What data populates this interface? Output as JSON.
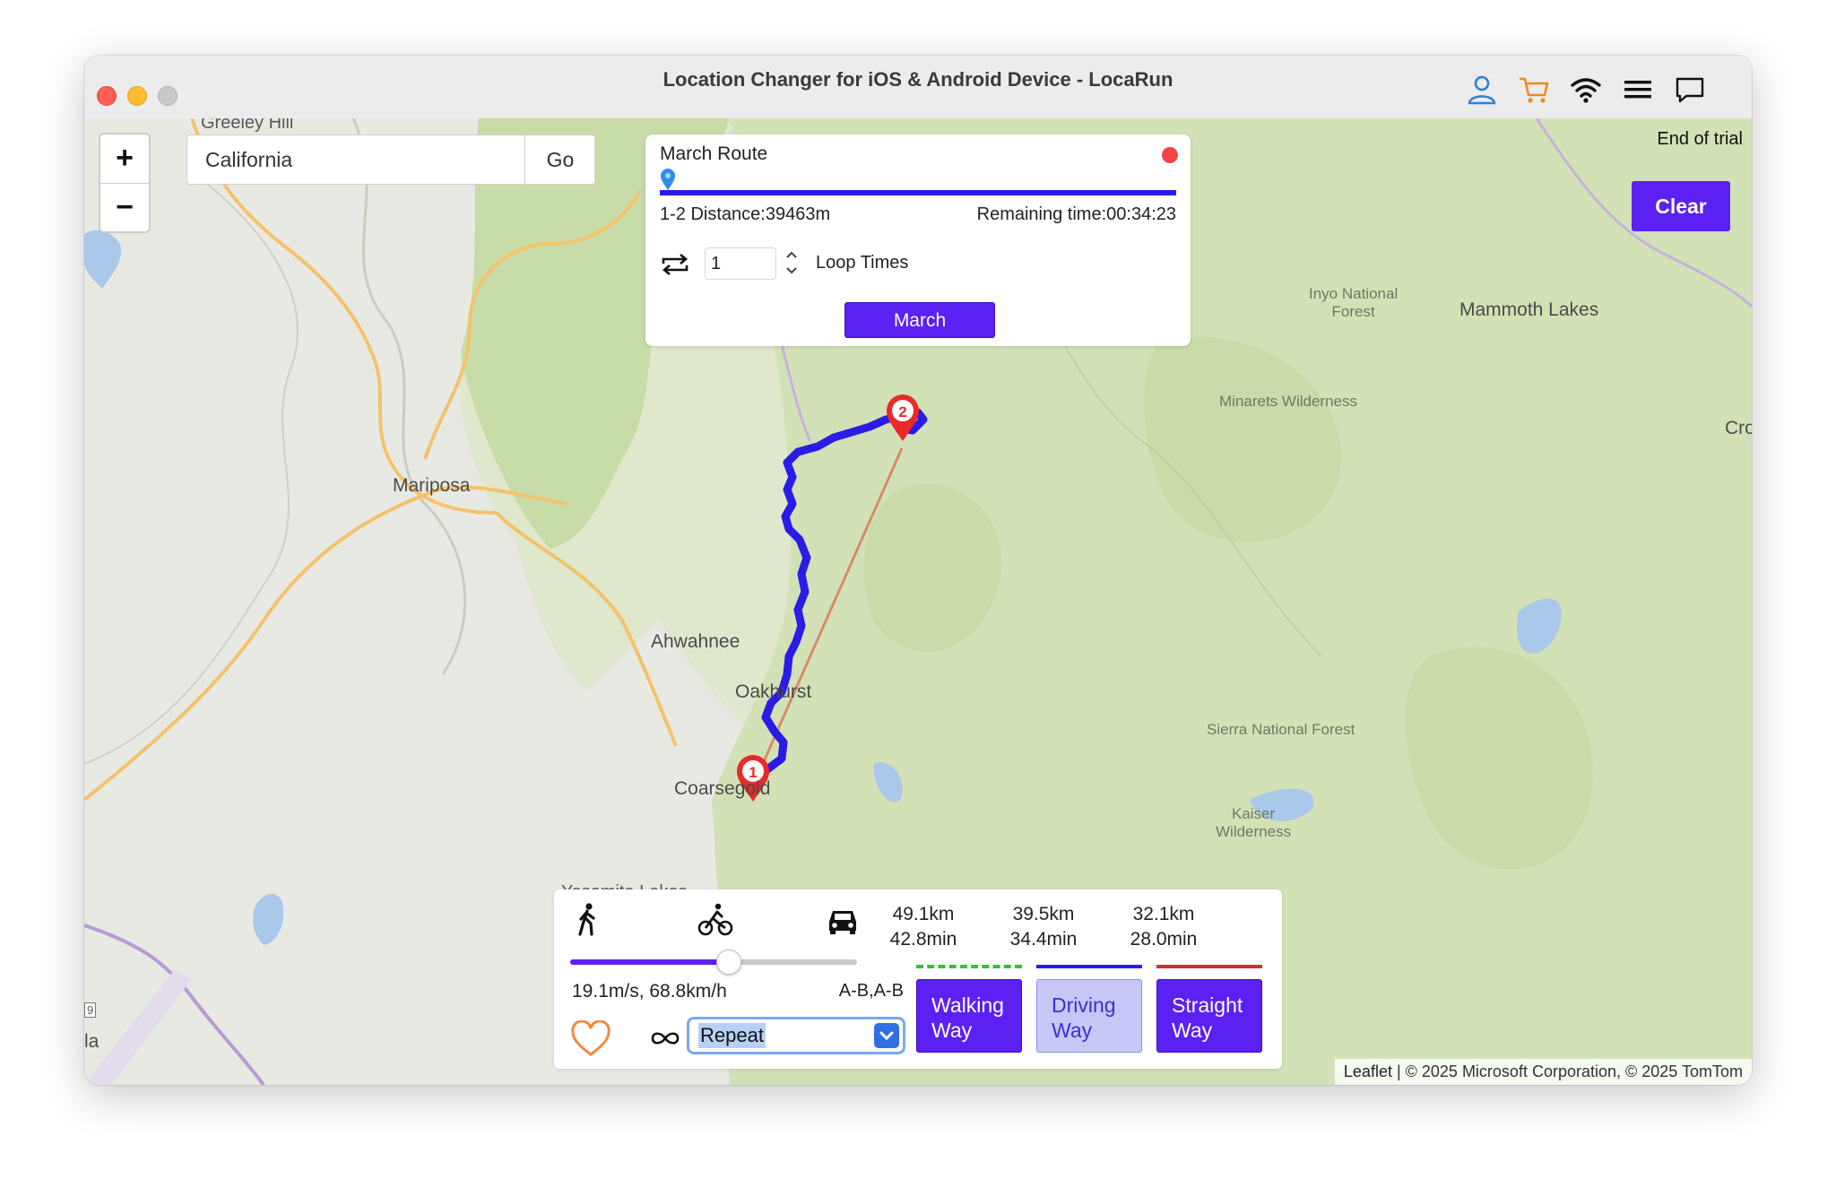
{
  "window": {
    "title": "Location Changer for iOS & Android Device - LocaRun",
    "toolbar_icons": [
      "user-icon",
      "cart-icon",
      "wifi-icon",
      "menu-icon",
      "chat-icon"
    ]
  },
  "map": {
    "zoom_in_label": "+",
    "zoom_out_label": "−",
    "search": {
      "value": "California",
      "placeholder": "",
      "go_label": "Go"
    },
    "trial_label": "End of trial",
    "clear_label": "Clear",
    "labels": {
      "greeley_hill": "Greeley Hill",
      "mariposa": "Mariposa",
      "ahwahnee": "Ahwahnee",
      "oakhurst": "Oakhurst",
      "coarsegold": "Coarsegold",
      "yosemite_lakes": "Yosemite Lakes",
      "mammoth_lakes": "Mammoth Lakes",
      "inyo_forest": "Inyo National\nForest",
      "minarets": "Minarets Wilderness",
      "sierra_forest": "Sierra National Forest",
      "kaiser": "Kaiser\nWilderness",
      "cro": "Cro",
      "la": "la",
      "route_shield": "9"
    },
    "markers": [
      {
        "label": "1"
      },
      {
        "label": "2"
      }
    ],
    "attribution": {
      "leaflet": "Leaflet",
      "text": " | © 2025 Microsoft Corporation, © 2025 TomTom"
    }
  },
  "route_panel": {
    "title": "March Route",
    "distance": "1-2 Distance:39463m",
    "remaining": "Remaining time:00:34:23",
    "loop_value": "1",
    "loop_label": "Loop Times",
    "march_label": "March",
    "progress": 0
  },
  "bottom_panel": {
    "speed_fraction": 0.55,
    "speed_text": "19.1m/s, 68.8km/h",
    "pattern": "A-B,A-B",
    "mode_select": "Repeat",
    "modes": [
      "walk-icon",
      "bike-icon",
      "car-icon"
    ],
    "routes": [
      {
        "distance": "49.1km",
        "time": "42.8min",
        "label_1": "Walking",
        "label_2": "Way",
        "line_color": "#3dbb3d",
        "line_style": "dashed",
        "state": "active"
      },
      {
        "distance": "39.5km",
        "time": "34.4min",
        "label_1": "Driving",
        "label_2": "Way",
        "line_color": "#2a1ce6",
        "line_style": "solid",
        "state": "alt"
      },
      {
        "distance": "32.1km",
        "time": "28.0min",
        "label_1": "Straight",
        "label_2": "Way",
        "line_color": "#d23030",
        "line_style": "solid",
        "state": "active"
      }
    ]
  }
}
